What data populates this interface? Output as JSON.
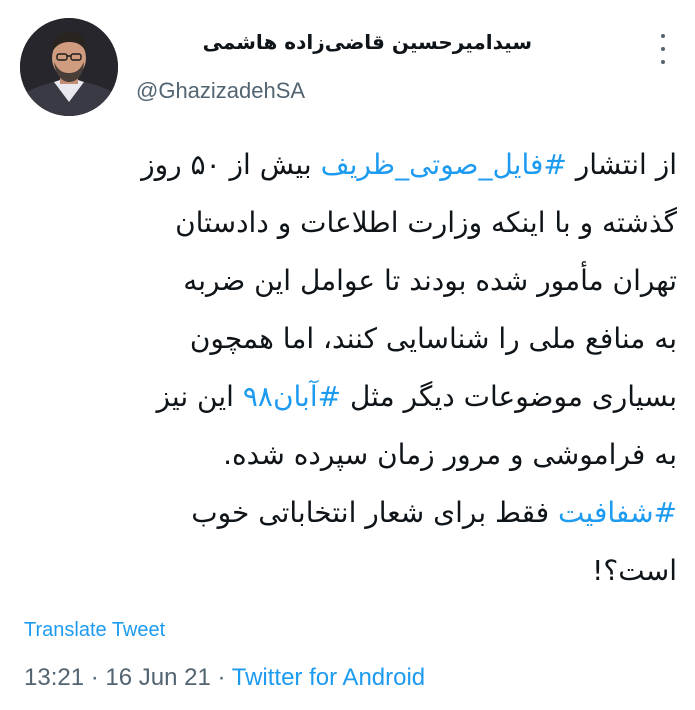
{
  "author": {
    "display_name": "سیدامیرحسین قاضی‌زاده هاشمی",
    "handle": "@GhazizadehSA",
    "avatar_icon": "person-portrait-avatar"
  },
  "tweet": {
    "lines": [
      {
        "pre": "از انتشار ",
        "tag": "#فایل_صوتی_ظریف",
        "post": " بیش از ۵۰ روز"
      },
      {
        "pre": "گذشته و با اینکه وزارت اطلاعات و دادستان",
        "tag": "",
        "post": ""
      },
      {
        "pre": "تهران مأمور شده بودند تا عوامل این ضربه",
        "tag": "",
        "post": ""
      },
      {
        "pre": "به منافع ملی را شناسایی کنند، اما همچون",
        "tag": "",
        "post": ""
      },
      {
        "pre": "بسیاری موضوعات دیگر مثل ",
        "tag": "#آبان۹۸",
        "post": " این نیز"
      },
      {
        "pre": "به فراموشی و مرور زمان سپرده شده.",
        "tag": "",
        "post": ""
      },
      {
        "pre": "",
        "tag": "#شفافیت",
        "post": " فقط برای شعار انتخاباتی خوب"
      },
      {
        "pre": "است؟!",
        "tag": "",
        "post": ""
      }
    ]
  },
  "translate_label": "Translate Tweet",
  "meta": {
    "time": "13:21",
    "date": "16 Jun 21",
    "separator": "·",
    "source": "Twitter for Android"
  },
  "colors": {
    "link": "#1d9bf0",
    "text": "#0f1419",
    "muted": "#536471"
  }
}
